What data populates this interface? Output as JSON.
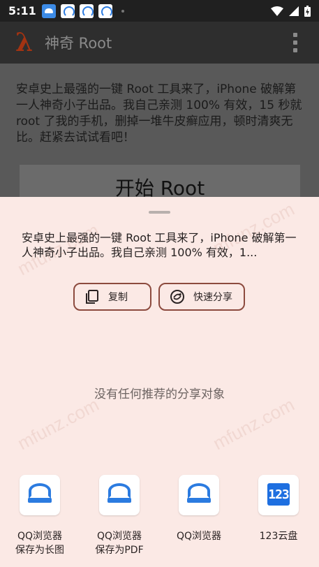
{
  "status_bar": {
    "time": "5:11"
  },
  "app_bar": {
    "title": "神奇 Root"
  },
  "content": {
    "body": "安卓史上最强的一键 Root 工具来了，iPhone 破解第一人神奇小子出品。我自己亲测 100% 有效，15 秒就 root 了我的手机，删掉一堆牛皮癣应用，顿时清爽无比。赶紧去试试看吧！",
    "start_button": "开始 Root"
  },
  "share_sheet": {
    "preview": "安卓史上最强的一键 Root 工具来了，iPhone 破解第一人神奇小子出品。我自己亲测 100% 有效，1...",
    "copy_label": "复制",
    "quick_share_label": "快速分享",
    "empty_message": "没有任何推荐的分享对象",
    "targets": [
      {
        "line1": "QQ浏览器",
        "line2": "保存为长图",
        "icon": "qq-browser-icon"
      },
      {
        "line1": "QQ浏览器",
        "line2": "保存为PDF",
        "icon": "qq-browser-icon"
      },
      {
        "line1": "QQ浏览器",
        "line2": "",
        "icon": "qq-browser-icon"
      },
      {
        "line1": "123云盘",
        "line2": "",
        "icon": "123-cloud-icon"
      }
    ]
  },
  "icons": {
    "yun_logo_text": "123"
  },
  "watermark": "mfunz.com",
  "colors": {
    "sheet_bg": "#fbe9e5",
    "button_border": "#8c4a3e",
    "app_bar": "#2e2e2e",
    "logo": "#a23312"
  }
}
